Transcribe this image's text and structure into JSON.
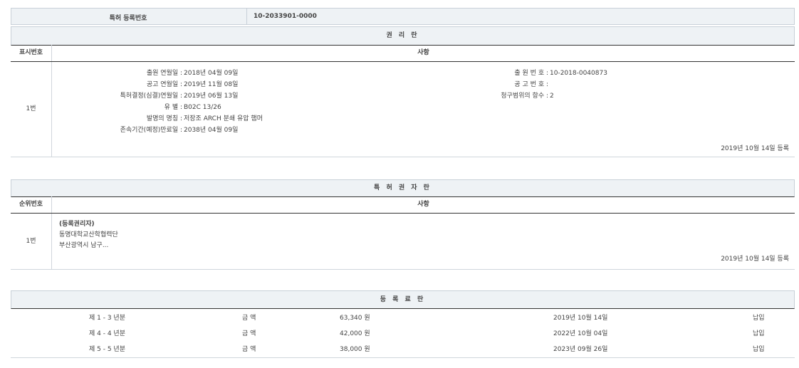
{
  "header": {
    "label": "특허 등록번호",
    "value": "10-2033901-0000"
  },
  "rights": {
    "title": "권 리 란",
    "col_index": "표시번호",
    "col_content": "사항",
    "row_index": "1번",
    "left": [
      {
        "label": "출원 연월일 :",
        "value": "2018년 04월 09일"
      },
      {
        "label": "공고 연월일 :",
        "value": "2019년 11월 08일"
      },
      {
        "label": "특허결정(심결)연월일 :",
        "value": "2019년 06월 13일"
      },
      {
        "label": "유 별 :",
        "value": "B02C 13/26"
      },
      {
        "label": "발명의 명칭 :",
        "value": "저장조 ARCH 분쇄 유압 햄머"
      },
      {
        "label": "존속기간(예정)만료일 :",
        "value": "2038년 04월 09일"
      }
    ],
    "right": [
      {
        "label": "출 원 번 호 :",
        "value": "10-2018-0040873"
      },
      {
        "label": "공 고 번 호 :",
        "value": ""
      },
      {
        "label": "청구범위의 항수 :",
        "value": "2"
      }
    ],
    "registered": "2019년 10월 14일 등록"
  },
  "holders": {
    "title": "특 허 권 자 란",
    "col_index": "순위번호",
    "col_content": "사항",
    "row_index": "1번",
    "lines": [
      "(등록권리자)",
      "동명대학교산학협력단",
      "부산광역시 남구..."
    ],
    "registered": "2019년 10월 14일 등록"
  },
  "fees": {
    "title": "등 록 료 란",
    "rows": [
      {
        "period": "제 1 - 3 년분",
        "amount_label": "금 액",
        "amount": "63,340 원",
        "date": "2019년 10월 14일",
        "status": "납입"
      },
      {
        "period": "제 4 - 4 년분",
        "amount_label": "금 액",
        "amount": "42,000 원",
        "date": "2022년 10월 04일",
        "status": "납입"
      },
      {
        "period": "제 5 - 5 년분",
        "amount_label": "금 액",
        "amount": "38,000 원",
        "date": "2023년 09월 26일",
        "status": "납입"
      }
    ]
  }
}
